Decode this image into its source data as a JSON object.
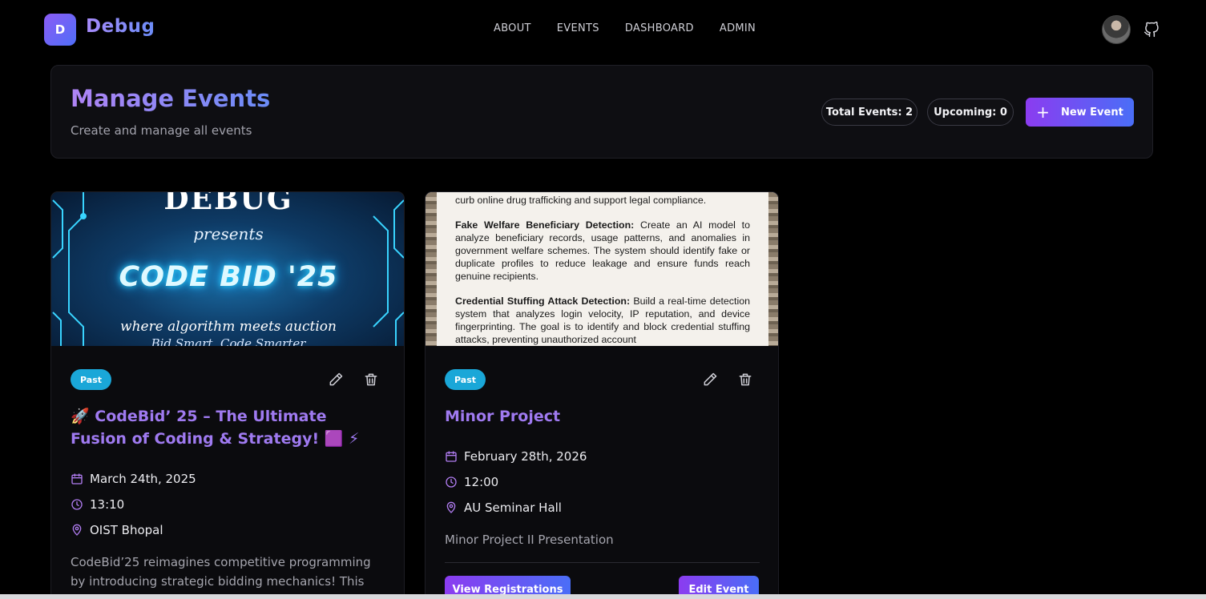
{
  "brand": {
    "logo_letter": "D",
    "name": "Debug"
  },
  "nav": {
    "items": [
      "ABOUT",
      "EVENTS",
      "DASHBOARD",
      "ADMIN"
    ]
  },
  "header": {
    "title": "Manage Events",
    "subtitle": "Create and manage all events",
    "total_events": "Total Events: 2",
    "upcoming": "Upcoming: 0",
    "new_event_label": "New Event"
  },
  "events": [
    {
      "poster": {
        "brand": "DEBUG",
        "presents": "presents",
        "title": "CODE BID '25",
        "tagline": "where algorithm meets auction",
        "tagline2": "Bid Smart, Code Smarter"
      },
      "status": "Past",
      "title": "🚀 CodeBid’ 25 – The Ultimate Fusion of Coding & Strategy! 🟪 ⚡",
      "date": "March 24th, 2025",
      "time": "13:10",
      "location": "OIST Bhopal",
      "description": "CodeBid’25 reimagines competitive programming by introducing strategic bidding mechanics! This"
    },
    {
      "poster": {
        "line0": "curb online drug trafficking and support legal compliance.",
        "h1": "Fake Welfare Beneficiary Detection:",
        "p1": "Create an AI model to analyze beneficiary records, usage patterns, and anomalies in government welfare schemes. The system should identify fake or duplicate profiles to reduce leakage and ensure funds reach genuine recipients.",
        "h2": "Credential Stuffing Attack Detection:",
        "p2": "Build a real-time detection system that analyzes login velocity, IP reputation, and device fingerprinting. The goal is to identify and block credential stuffing attacks, preventing unauthorized account"
      },
      "status": "Past",
      "title": "Minor Project",
      "date": "February 28th, 2026",
      "time": "12:00",
      "location": "AU Seminar Hall",
      "description": "Minor Project II Presentation",
      "view_registrations_label": "View Registrations",
      "edit_event_label": "Edit Event"
    }
  ],
  "colors": {
    "accent_purple": "#9f7af0",
    "accent_blue": "#4a6ef7",
    "badge_past": "#1aa7d8",
    "background": "#000000"
  },
  "icons": [
    "github-icon",
    "calendar-icon",
    "clock-icon",
    "map-pin-icon",
    "pencil-icon",
    "trash-icon",
    "plus-icon"
  ]
}
